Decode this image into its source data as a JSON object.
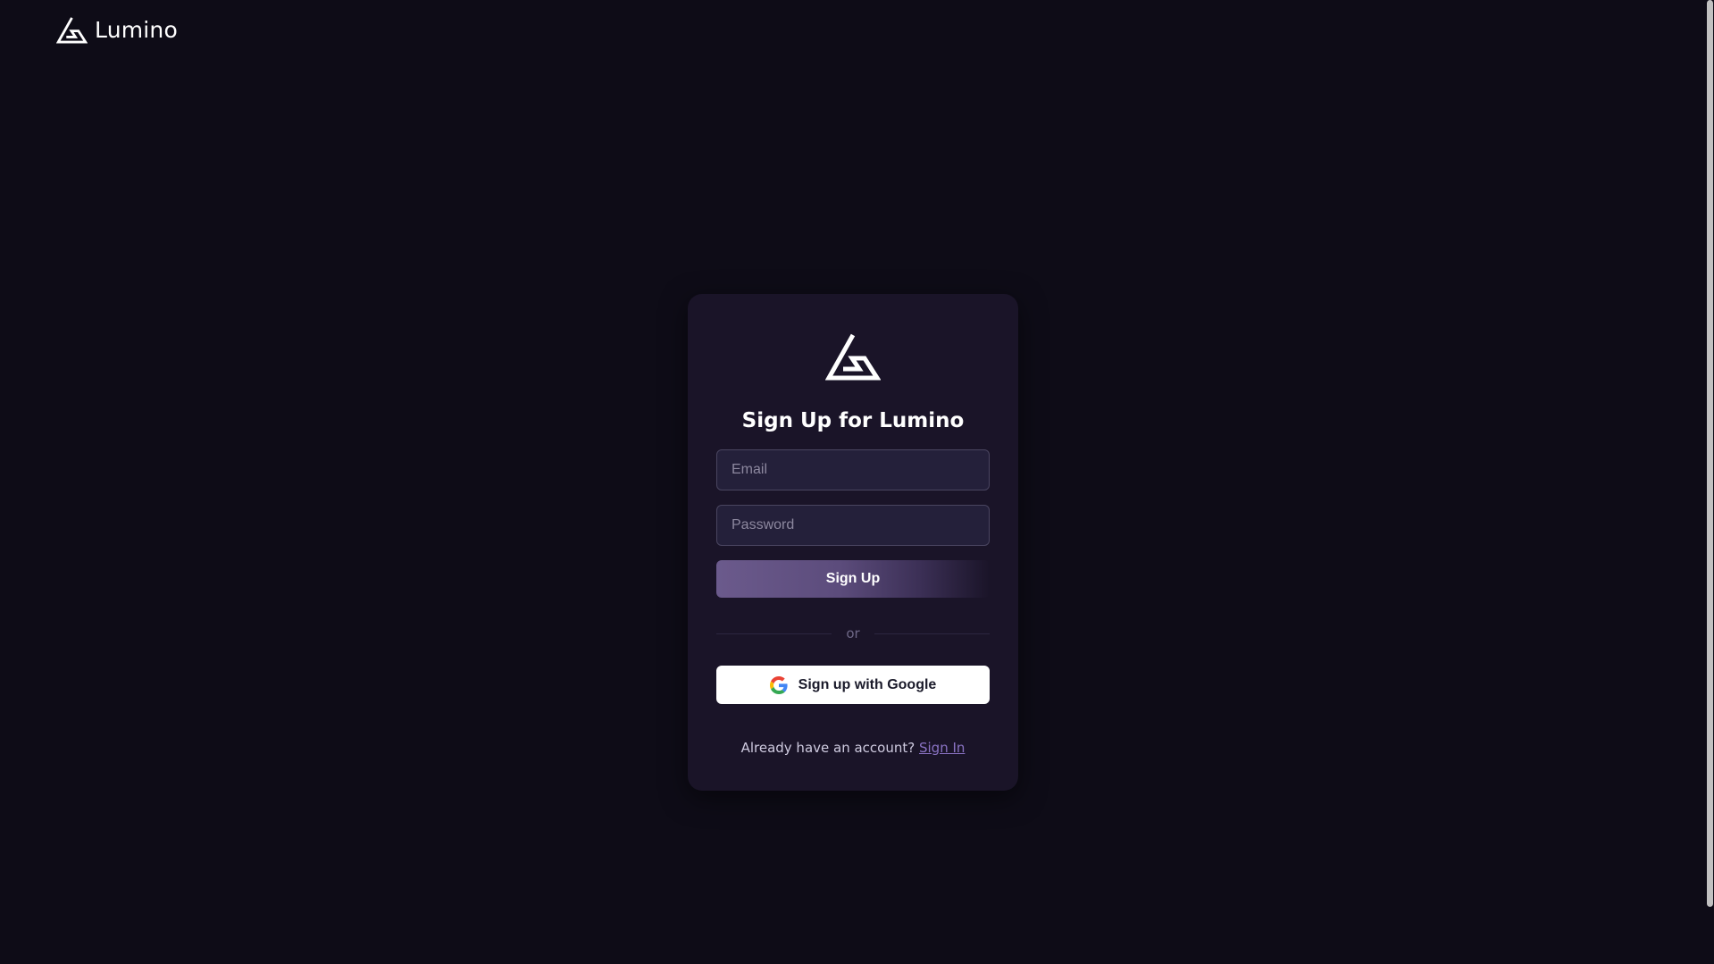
{
  "header": {
    "brand_name": "Lumino",
    "logo_icon": "lumino-triangle-logo-icon"
  },
  "card": {
    "logo_icon": "lumino-triangle-logo-icon",
    "title": "Sign Up for Lumino",
    "email": {
      "placeholder": "Email",
      "value": ""
    },
    "password": {
      "placeholder": "Password",
      "value": ""
    },
    "signup_label": "Sign Up",
    "divider_text": "or",
    "google": {
      "icon": "google-g-icon",
      "label": "Sign up with Google"
    },
    "footer": {
      "prompt": "Already have an account?",
      "link_label": "Sign In"
    }
  },
  "colors": {
    "background": "#0e0c17",
    "card": "#1a1428",
    "primary_button": "#6b5a8c",
    "link": "#8a73c4"
  }
}
